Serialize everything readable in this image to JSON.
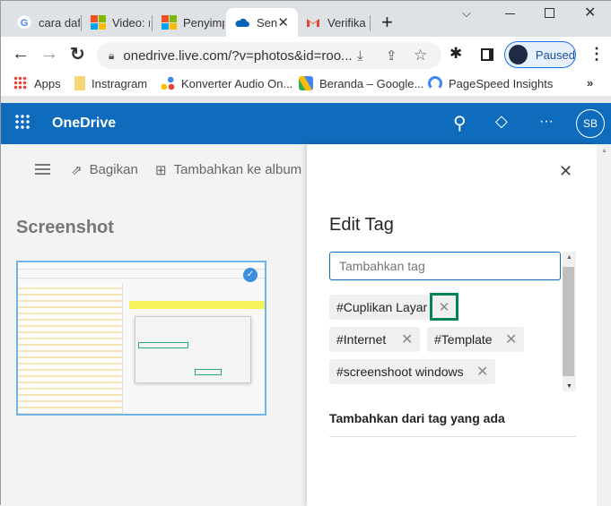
{
  "browser": {
    "tabs": [
      {
        "title": "cara daf",
        "icon": "google-icon"
      },
      {
        "title": "Video: r",
        "icon": "microsoft-icon"
      },
      {
        "title": "Penyimp",
        "icon": "microsoft-icon"
      },
      {
        "title": "Sen",
        "icon": "onedrive-cloud-icon",
        "active": true
      },
      {
        "title": "Verifika",
        "icon": "gmail-icon"
      }
    ],
    "new_tab": "+",
    "url": "onedrive.live.com/?v=photos&id=roo...",
    "profile_label": "Paused",
    "bookmarks": [
      {
        "label": "Apps",
        "icon": "apps-grid-icon"
      },
      {
        "label": "Instragram",
        "icon": "folder-icon"
      },
      {
        "label": "Konverter Audio On...",
        "icon": "dots-icon"
      },
      {
        "label": "Beranda – Google...",
        "icon": "google-ads-icon"
      },
      {
        "label": "PageSpeed Insights",
        "icon": "pagespeed-icon"
      }
    ],
    "more_bookmarks": "»"
  },
  "onedrive": {
    "brand": "OneDrive",
    "avatar_initials": "SB",
    "more": "···",
    "accent": "#0f6cbd"
  },
  "main": {
    "share_label": "Bagikan",
    "add_album_label": "Tambahkan ke album",
    "album_title": "Screenshot"
  },
  "panel": {
    "title": "Edit Tag",
    "input_placeholder": "Tambahkan tag",
    "tags": [
      "#Cuplikan Layar",
      "#Internet",
      "#Template",
      "#screenshoot windows"
    ],
    "existing_heading": "Tambahkan dari tag yang ada",
    "highlight_color": "#008556"
  }
}
